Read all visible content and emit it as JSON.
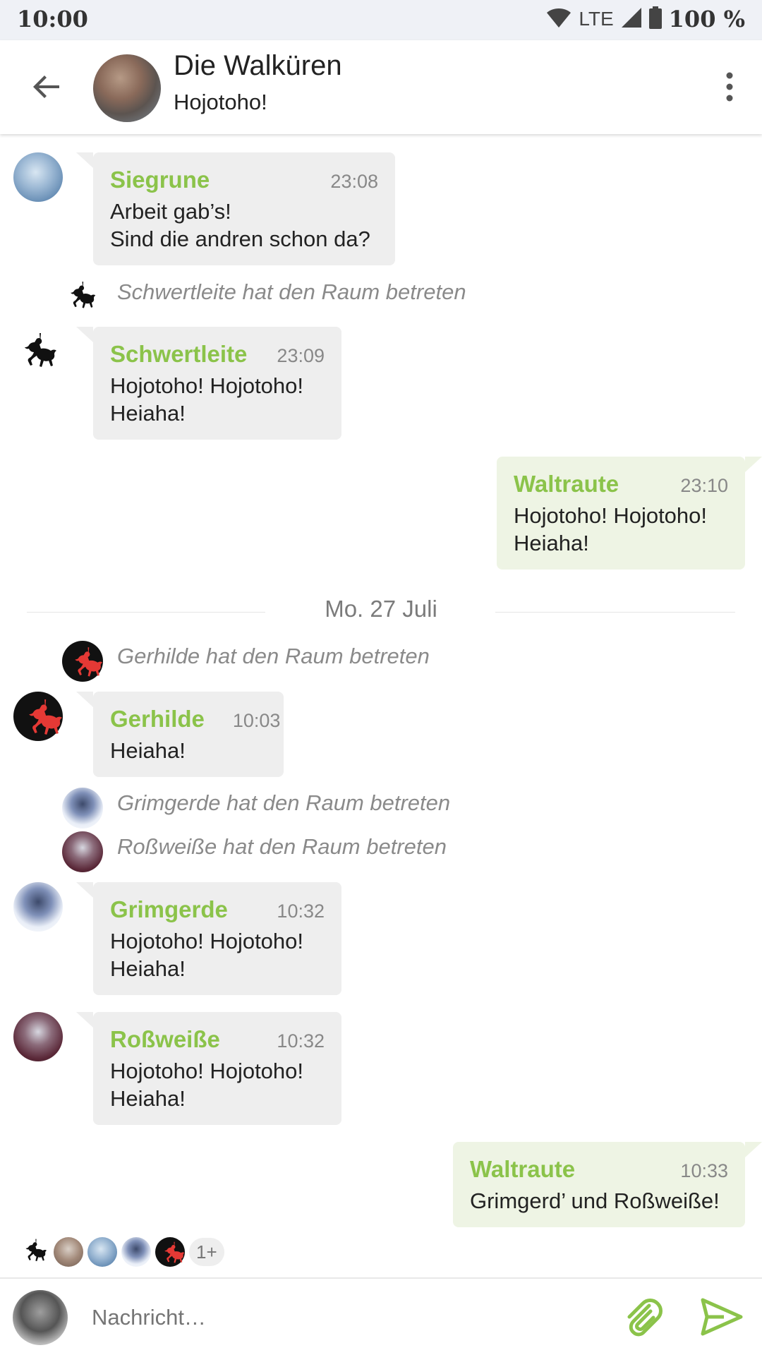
{
  "status_bar": {
    "time": "10:00",
    "network": "LTE",
    "battery": "100 %",
    "icons": [
      "wifi-icon",
      "signal-icon",
      "battery-icon"
    ]
  },
  "header": {
    "title": "Die Walküren",
    "subtitle": "Hojotoho!",
    "icons": [
      "back-arrow-icon",
      "more-vert-icon"
    ]
  },
  "messages": [
    {
      "sender": "Siegrune",
      "time": "23:08",
      "text": "Arbeit gab’s!\nSind die andren schon da?"
    },
    {
      "event": "Schwertleite hat den Raum betreten"
    },
    {
      "sender": "Schwertleite",
      "time": "23:09",
      "text": "Hojotoho! Hojotoho!\nHeiaha!"
    },
    {
      "sender": "Waltraute",
      "time": "23:10",
      "text": "Hojotoho! Hojotoho!\nHeiaha!"
    },
    {
      "date": "Mo. 27 Juli"
    },
    {
      "event": "Gerhilde hat den Raum betreten"
    },
    {
      "sender": "Gerhilde",
      "time": "10:03",
      "text": "Heiaha!"
    },
    {
      "event": "Grimgerde hat den Raum betreten"
    },
    {
      "event": "Roßweiße hat den Raum betreten"
    },
    {
      "sender": "Grimgerde",
      "time": "10:32",
      "text": "Hojotoho! Hojotoho!\nHeiaha!"
    },
    {
      "sender": "Roßweiße",
      "time": "10:32",
      "text": "Hojotoho! Hojotoho!\nHeiaha!"
    },
    {
      "sender": "Waltraute",
      "time": "10:33",
      "text": "Grimgerd’ und Roßweiße!"
    }
  ],
  "read_receipts": {
    "more": "1+"
  },
  "composer": {
    "placeholder": "Nachricht…",
    "icons": [
      "attach-icon",
      "send-icon"
    ]
  },
  "colors": {
    "accent": "#8bc34a",
    "bubble_incoming": "#eeeeee",
    "bubble_outgoing": "#eef4e4",
    "status_bar": "#eff1f6"
  }
}
